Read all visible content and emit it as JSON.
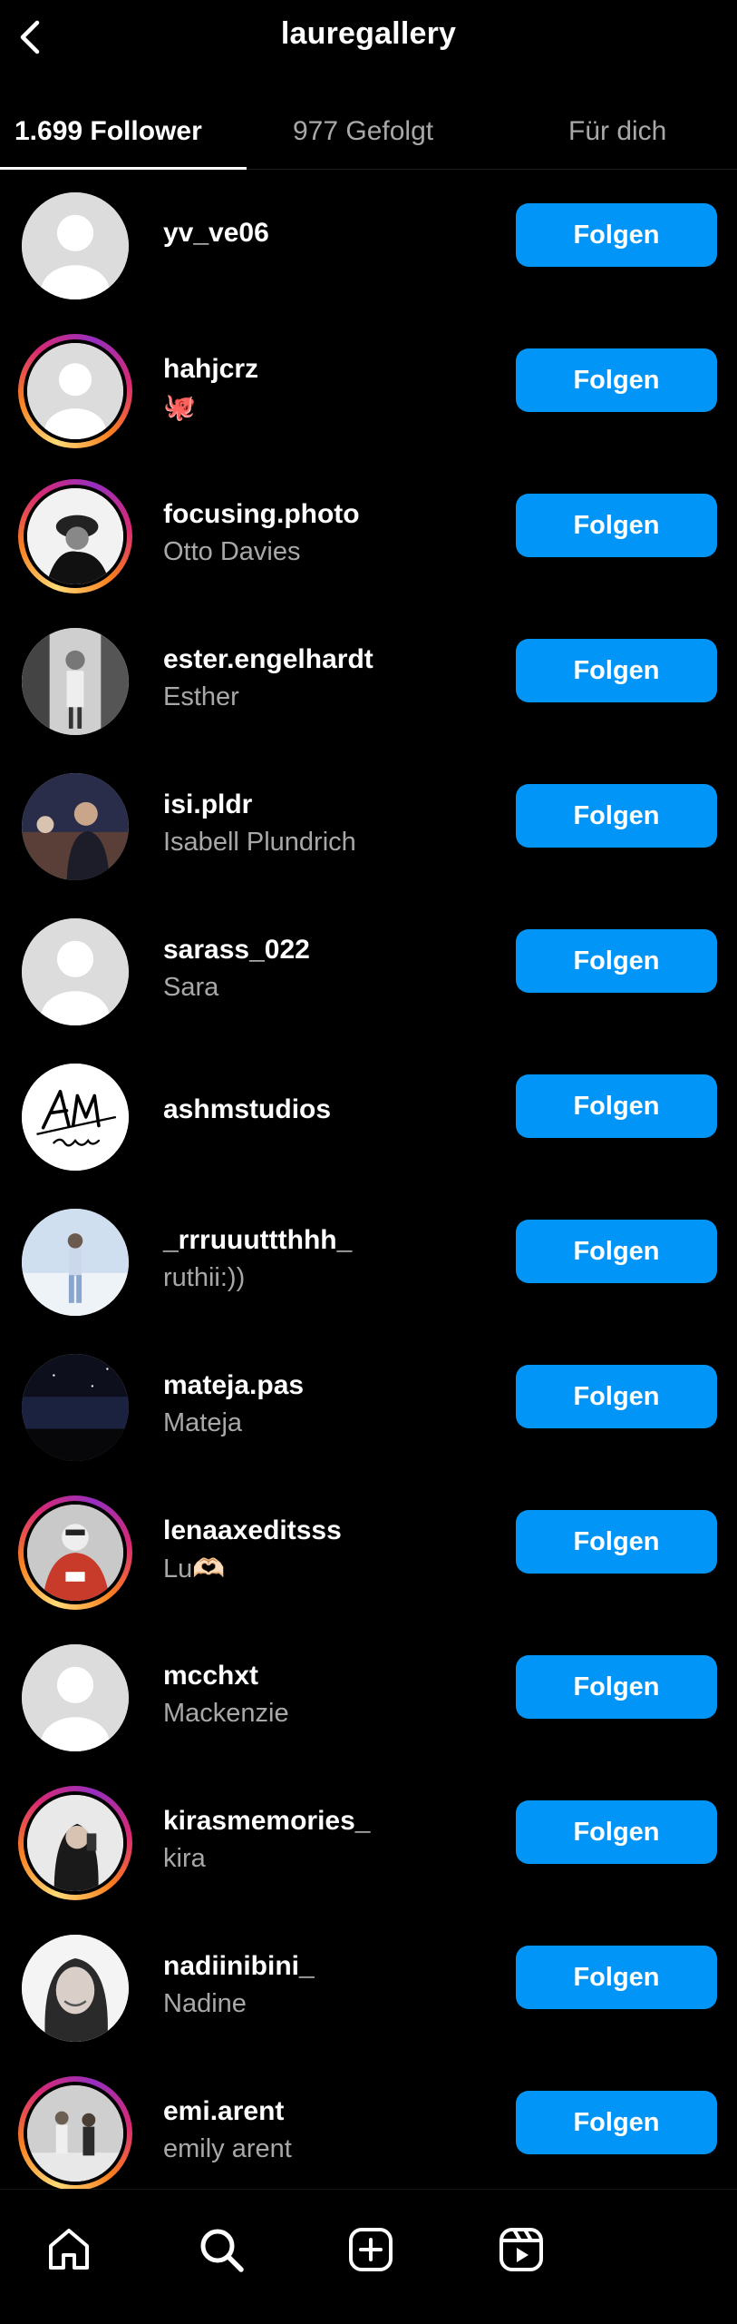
{
  "header": {
    "title": "lauregallery"
  },
  "tabs": [
    {
      "label": "1.699 Follower",
      "active": true
    },
    {
      "label": "977 Gefolgt",
      "active": false
    },
    {
      "label": "Für dich",
      "active": false
    }
  ],
  "follow_label": "Folgen",
  "followers": [
    {
      "username": "yv_ve06",
      "name": "",
      "avatar": "default",
      "story_ring": false
    },
    {
      "username": "hahjcrz",
      "name": "🐙",
      "avatar": "default",
      "story_ring": true
    },
    {
      "username": "focusing.photo",
      "name": "Otto Davies",
      "avatar": "photo",
      "story_ring": true
    },
    {
      "username": "ester.engelhardt",
      "name": "Esther",
      "avatar": "photo",
      "story_ring": false
    },
    {
      "username": "isi.pldr",
      "name": "Isabell Plundrich",
      "avatar": "photo",
      "story_ring": false
    },
    {
      "username": "sarass_022",
      "name": "Sara",
      "avatar": "default",
      "story_ring": false
    },
    {
      "username": "ashmstudios",
      "name": "",
      "avatar": "logo",
      "story_ring": false
    },
    {
      "username": "_rrruuuttthhh_",
      "name": "ruthii:))",
      "avatar": "photo",
      "story_ring": false
    },
    {
      "username": "mateja.pas",
      "name": "Mateja",
      "avatar": "photo",
      "story_ring": false
    },
    {
      "username": "lenaaxeditsss",
      "name": "Lu🫶🏻",
      "avatar": "photo",
      "story_ring": true
    },
    {
      "username": "mcchxt",
      "name": "Mackenzie",
      "avatar": "default",
      "story_ring": false
    },
    {
      "username": "kirasmemories_",
      "name": "kira",
      "avatar": "photo",
      "story_ring": true
    },
    {
      "username": "nadiinibini_",
      "name": "Nadine",
      "avatar": "photo",
      "story_ring": false
    },
    {
      "username": "emi.arent",
      "name": "emily arent",
      "avatar": "photo",
      "story_ring": true
    }
  ],
  "bottom_nav": [
    {
      "icon": "home-icon"
    },
    {
      "icon": "search-icon"
    },
    {
      "icon": "create-icon"
    },
    {
      "icon": "reels-icon"
    }
  ]
}
